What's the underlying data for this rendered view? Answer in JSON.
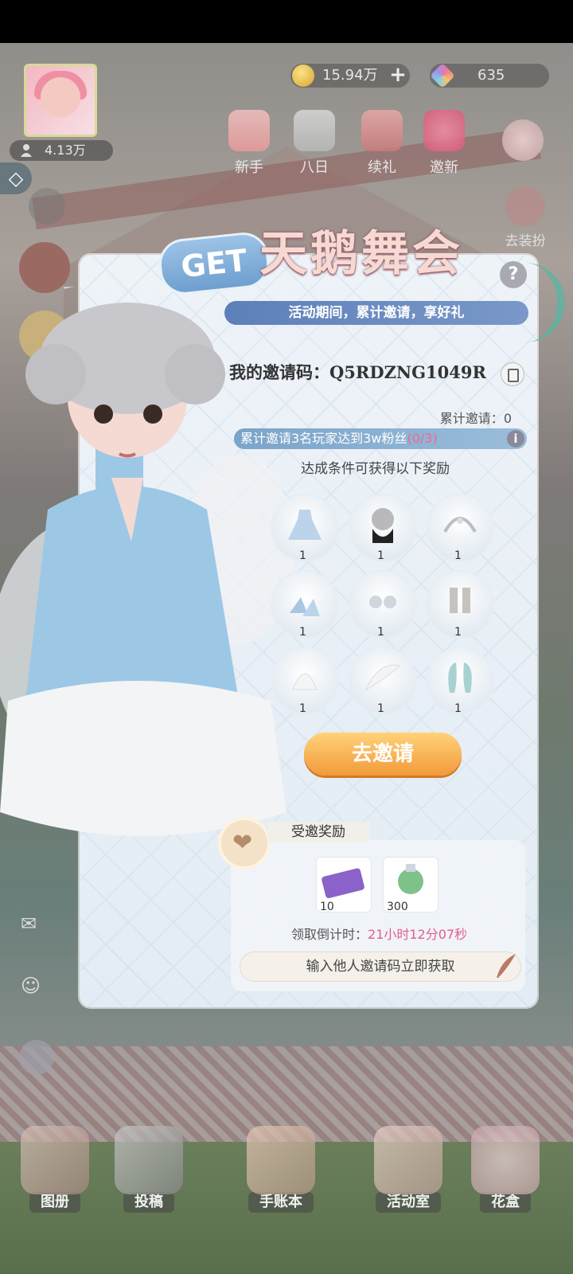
{
  "top_bar": {
    "fans": "4.13万",
    "gold": "15.94万",
    "gems": "635",
    "icons": [
      {
        "label": "新手",
        "icon": "newbie-gift-icon"
      },
      {
        "label": "八日",
        "icon": "eight-day-icon"
      },
      {
        "label": "续礼",
        "icon": "renew-gift-icon"
      },
      {
        "label": "邀新",
        "icon": "invite-heart-icon"
      }
    ],
    "right_side_label": "去装扮"
  },
  "event": {
    "badge": "GET",
    "title": "天鹅舞会",
    "subtitle": "活动期间，累计邀请，享好礼",
    "invite_code_label": "我的邀请码：",
    "invite_code": "Q5RDZNG1049R",
    "cumulative_label": "累计邀请：",
    "cumulative_value": "0",
    "progress_text": "累计邀请3名玩家达到3w粉丝",
    "progress_count": "(0/3)",
    "reward_hint": "达成条件可获得以下奖励",
    "rewards": [
      {
        "name": "dress",
        "qty": "1"
      },
      {
        "name": "hairstyle",
        "qty": "1"
      },
      {
        "name": "headpiece",
        "qty": "1"
      },
      {
        "name": "shoes",
        "qty": "1"
      },
      {
        "name": "earrings",
        "qty": "1"
      },
      {
        "name": "socks",
        "qty": "1"
      },
      {
        "name": "gloves",
        "qty": "1"
      },
      {
        "name": "wings",
        "qty": "1"
      },
      {
        "name": "back-ornament",
        "qty": "1"
      }
    ],
    "invite_button": "去邀请"
  },
  "invited_reward": {
    "tag": "受邀奖励",
    "items": [
      {
        "name": "gift-ticket",
        "qty": "10"
      },
      {
        "name": "potion",
        "qty": "300"
      }
    ],
    "countdown_label": "领取倒计时：",
    "countdown_value": "21小时12分07秒",
    "input_placeholder": "输入他人邀请码立即获取"
  },
  "dock": [
    {
      "label": "图册"
    },
    {
      "label": "投稿"
    },
    {
      "label": "手账本"
    },
    {
      "label": "活动室"
    },
    {
      "label": "花盒"
    }
  ],
  "colors": {
    "accent_blue": "#5d80ba",
    "invite_orange": "#f29a3a",
    "countdown_pink": "#e35d8a"
  }
}
